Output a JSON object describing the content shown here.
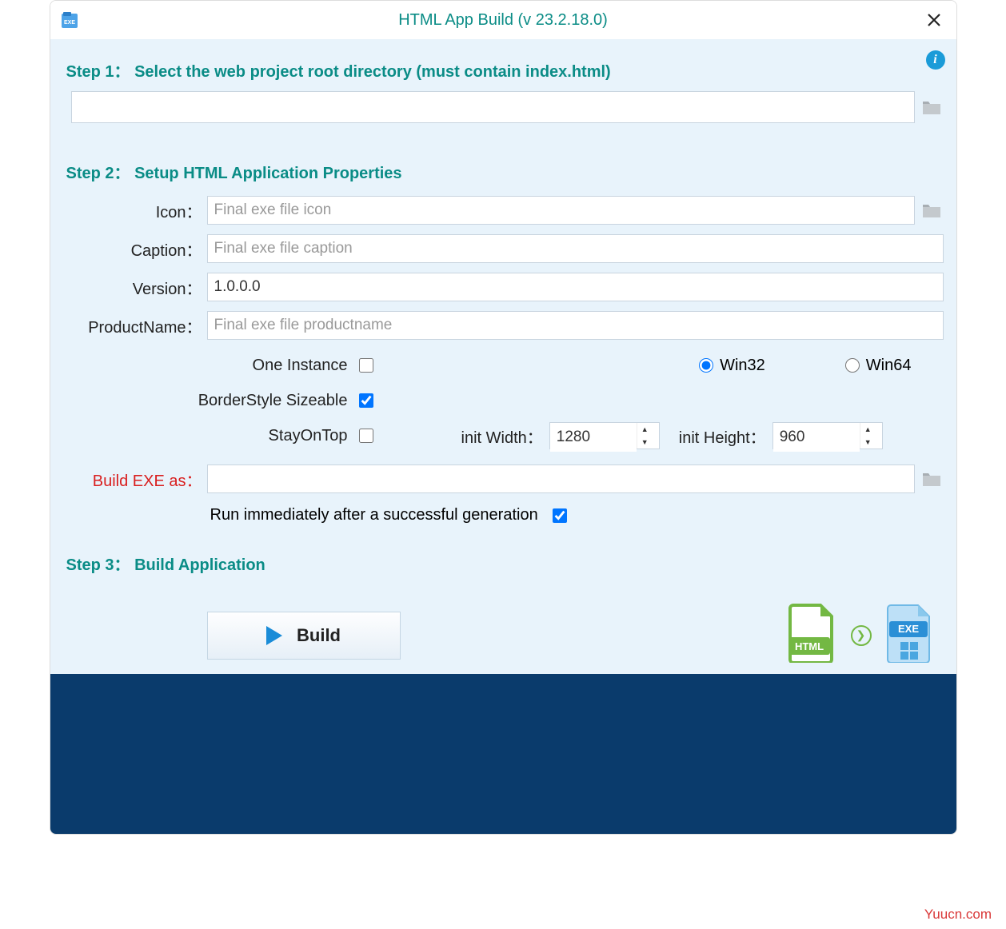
{
  "titlebar": {
    "title": "HTML App Build  (v 23.2.18.0)"
  },
  "step1": {
    "header": "Step  1：  Select the web project root directory (must contain index.html)",
    "path_value": ""
  },
  "step2": {
    "header": "Step  2：  Setup HTML Application Properties",
    "labels": {
      "icon": "Icon：",
      "caption": "Caption：",
      "version": "Version：",
      "productname": "ProductName：",
      "one_instance": "One Instance",
      "border_sizeable": "BorderStyle Sizeable",
      "stay_on_top": "StayOnTop",
      "win32": "Win32",
      "win64": "Win64",
      "init_width": "init Width：",
      "init_height": "init Height：",
      "build_exe_as": "Build EXE as：",
      "run_after": "Run immediately after a successful generation"
    },
    "placeholders": {
      "icon": "Final exe file icon",
      "caption": "Final exe file caption",
      "productname": "Final exe file productname"
    },
    "values": {
      "version": "1.0.0.0",
      "init_width": "1280",
      "init_height": "960",
      "build_exe_as": ""
    },
    "checkboxes": {
      "one_instance": false,
      "border_sizeable": true,
      "stay_on_top": false,
      "run_after": true
    },
    "arch": "win32"
  },
  "step3": {
    "header": "Step  3：  Build Application",
    "build_label": "Build"
  },
  "watermark": "Yuucn.com"
}
